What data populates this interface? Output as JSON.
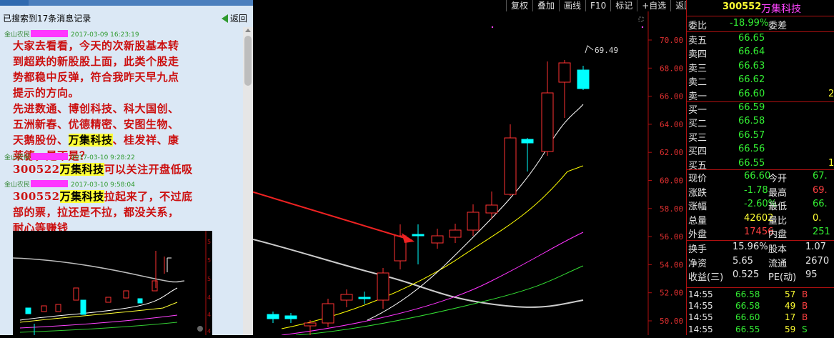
{
  "chat": {
    "search_summary": "已搜索到17条消息记录",
    "back_label": "返回",
    "messages": [
      {
        "user": "金山农民",
        "time": "2017-03-09 16:23:19",
        "line1": "大家去看看，今天的次新股基本转",
        "line2": "到超跌的新股股上面，此类个股走",
        "line3": "势都稳中反弹，符合我昨天早九点",
        "line4": "提示的方向。",
        "line5": "先进数通、博创科技、科大国创、",
        "line6": "五洲新春、优德精密、安图生物、",
        "line7a": "天鹅股份、",
        "line7_hl": "万集科技",
        "line7b": "、桂发祥、康",
        "line8": "莱德，是不是？"
      },
      {
        "user": "金山农民",
        "time": "2017-03-10 9:28:22",
        "code": "300522",
        "name_hl": "万集科技",
        "rest": "可以关注开盘低吸"
      },
      {
        "user": "金山农民",
        "time": "2017-03-10 9:58:04",
        "code": "300552",
        "name_hl": "万集科技",
        "rest1": "拉起来了，不过底",
        "line2": "部的票，拉还是不拉，都没关系，",
        "line3": "耐心等赚钱"
      }
    ],
    "thumb_ticks": [
      "5",
      "5",
      "5",
      "4",
      "4",
      "4"
    ]
  },
  "toolbar": [
    "复权",
    "叠加",
    "画线",
    "F10",
    "标记",
    "+自选",
    "返回"
  ],
  "chart": {
    "high_label": "69.49",
    "y_ticks": [
      "70.00",
      "68.00",
      "66.00",
      "64.00",
      "62.00",
      "60.00",
      "58.00",
      "56.00",
      "54.00",
      "52.00",
      "50.00"
    ],
    "colors": {
      "up": "#ff3232",
      "down": "#00ffff",
      "ma5": "#ffffff",
      "ma10": "#ffff00",
      "ma20": "#ff33ff",
      "ma30": "#33dd33",
      "ma60": "#cccccc",
      "axis": "#b01010"
    }
  },
  "quote": {
    "code": "300552",
    "name": "万集科技",
    "weibi_label": "委比",
    "weibi": "-18.99%",
    "weicha_label": "委差",
    "asks": [
      {
        "label": "卖五",
        "price": "66.65",
        "vol": ""
      },
      {
        "label": "卖四",
        "price": "66.64",
        "vol": ""
      },
      {
        "label": "卖三",
        "price": "66.63",
        "vol": ""
      },
      {
        "label": "卖二",
        "price": "66.62",
        "vol": ""
      },
      {
        "label": "卖一",
        "price": "66.60",
        "vol": "2"
      }
    ],
    "bids": [
      {
        "label": "买一",
        "price": "66.59",
        "vol": ""
      },
      {
        "label": "买二",
        "price": "66.58",
        "vol": ""
      },
      {
        "label": "买三",
        "price": "66.57",
        "vol": ""
      },
      {
        "label": "买四",
        "price": "66.56",
        "vol": ""
      },
      {
        "label": "买五",
        "price": "66.55",
        "vol": "1"
      }
    ],
    "stats": [
      {
        "l1": "现价",
        "v1": "66.60",
        "c1": "g",
        "l2": "今开",
        "v2": "67.",
        "c2": "g"
      },
      {
        "l1": "涨跌",
        "v1": "-1.78",
        "c1": "g",
        "l2": "最高",
        "v2": "69.",
        "c2": "r"
      },
      {
        "l1": "涨幅",
        "v1": "-2.60%",
        "c1": "g",
        "l2": "最低",
        "v2": "66.",
        "c2": "g"
      },
      {
        "l1": "总量",
        "v1": "42602",
        "c1": "y",
        "l2": "量比",
        "v2": "0.",
        "c2": "y"
      },
      {
        "l1": "外盘",
        "v1": "17456",
        "c1": "r",
        "l2": "内盘",
        "v2": "251",
        "c2": "g"
      }
    ],
    "stats2": [
      {
        "l1": "换手",
        "v1": "15.96%",
        "c1": "w",
        "l2": "股本",
        "v2": "1.07",
        "c2": "w"
      },
      {
        "l1": "净资",
        "v1": "5.65",
        "c1": "w",
        "l2": "流通",
        "v2": "2670",
        "c2": "w"
      },
      {
        "l1": "收益(三)",
        "v1": "0.525",
        "c1": "w",
        "l2": "PE(动)",
        "v2": "95",
        "c2": "w"
      }
    ],
    "ticks": [
      {
        "time": "14:55",
        "price": "66.58",
        "vol": "57",
        "side": "B"
      },
      {
        "time": "14:55",
        "price": "66.58",
        "vol": "49",
        "side": "B"
      },
      {
        "time": "14:55",
        "price": "66.60",
        "vol": "17",
        "side": "B"
      },
      {
        "time": "14:55",
        "price": "66.55",
        "vol": "59",
        "side": "S"
      }
    ]
  }
}
